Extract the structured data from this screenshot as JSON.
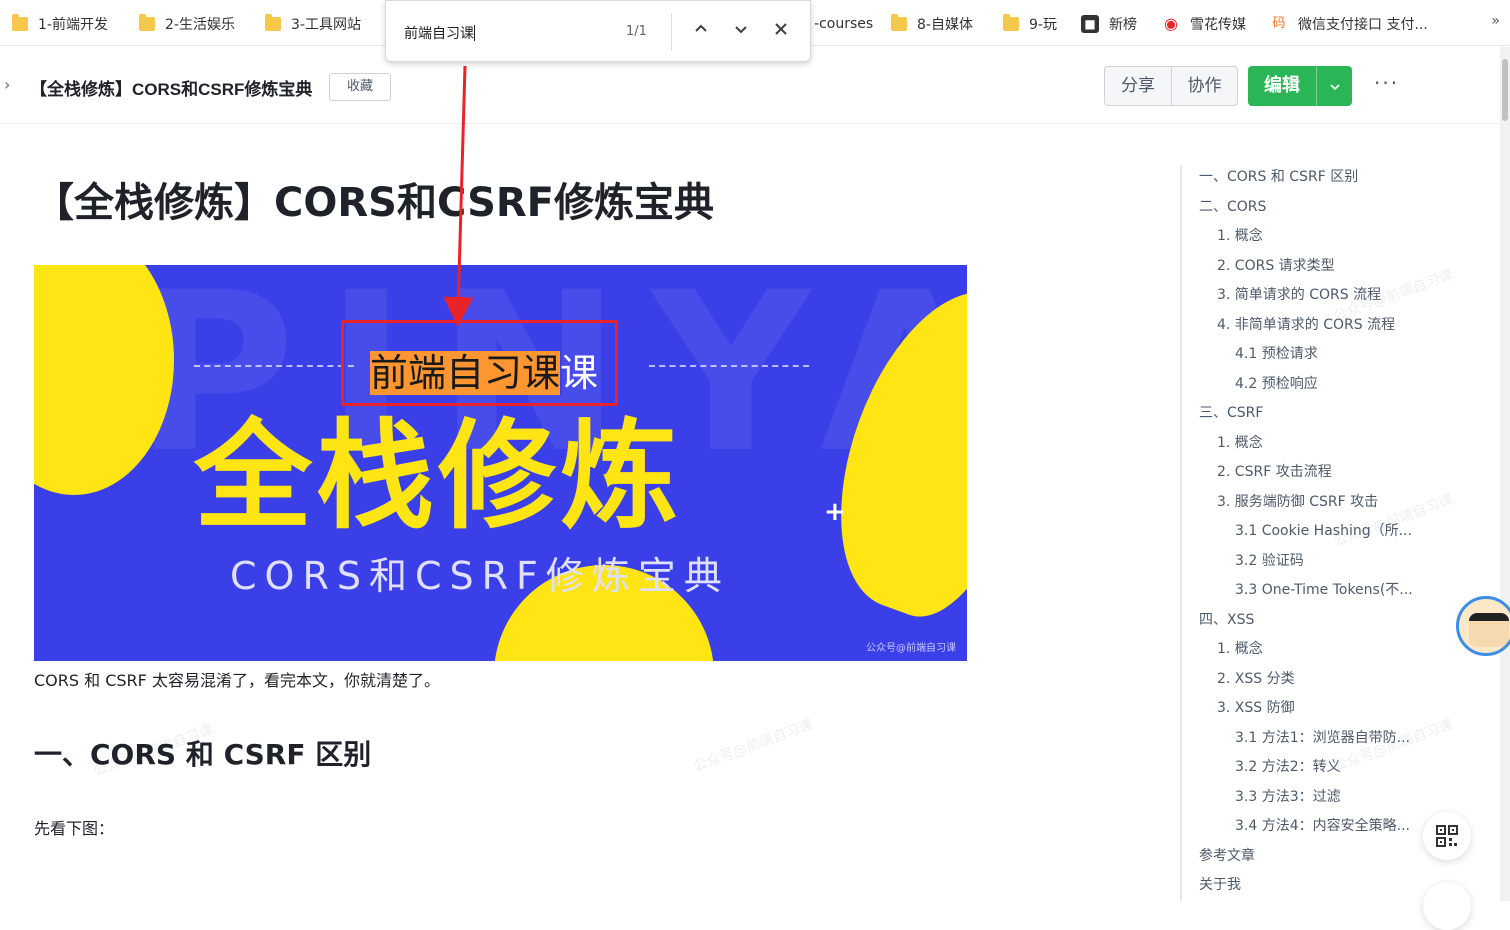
{
  "bookmarks": {
    "items": [
      {
        "label": "1-前端开发",
        "icon": "folder-icon"
      },
      {
        "label": "2-生活娱乐",
        "icon": "folder-icon"
      },
      {
        "label": "3-工具网站",
        "icon": "folder-icon"
      },
      {
        "label": "-courses",
        "icon": "folder-icon"
      },
      {
        "label": "8-自媒体",
        "icon": "folder-icon"
      },
      {
        "label": "9-玩",
        "icon": "folder-icon"
      },
      {
        "label": "新榜",
        "icon": "xinbang-icon"
      },
      {
        "label": "雪花传媒",
        "icon": "xuehua-icon"
      },
      {
        "label": "微信支付接口 支付...",
        "icon": "wechatpay-icon"
      }
    ],
    "more": "»"
  },
  "find_bar": {
    "query": "前端自习课",
    "count": "1/1",
    "prev": "^",
    "next": "v",
    "close": "✕"
  },
  "header": {
    "collapse_icon": "›",
    "title": "【全栈修炼】CORS和CSRF修炼宝典",
    "favorite": "收藏",
    "share": "分享",
    "collaborate": "协作",
    "edit": "编辑",
    "edit_caret": "⌄",
    "more": "···"
  },
  "article": {
    "title": "【全栈修炼】CORS和CSRF修炼宝典",
    "banner": {
      "subtitle_highlight": "前端自习课",
      "subtitle_rest": "课",
      "main": "全栈修炼",
      "plus": "+",
      "english": "CORS和CSRF修炼宝典",
      "watermark": "公众号@前端自习课"
    },
    "intro": "CORS 和 CSRF 太容易混淆了，看完本文，你就清楚了。",
    "section1_heading": "一、CORS 和 CSRF 区别",
    "section1_text": "先看下图："
  },
  "toc": [
    {
      "label": "一、CORS 和 CSRF 区别",
      "level": 1
    },
    {
      "label": "二、CORS",
      "level": 1
    },
    {
      "label": "1. 概念",
      "level": 2
    },
    {
      "label": "2. CORS 请求类型",
      "level": 2
    },
    {
      "label": "3. 简单请求的 CORS 流程",
      "level": 2
    },
    {
      "label": "4. 非简单请求的 CORS 流程",
      "level": 2
    },
    {
      "label": "4.1 预检请求",
      "level": 3
    },
    {
      "label": "4.2 预检响应",
      "level": 3
    },
    {
      "label": "三、CSRF",
      "level": 1
    },
    {
      "label": "1. 概念",
      "level": 2
    },
    {
      "label": "2. CSRF 攻击流程",
      "level": 2
    },
    {
      "label": "3. 服务端防御 CSRF 攻击",
      "level": 2
    },
    {
      "label": "3.1 Cookie Hashing（所...",
      "level": 3
    },
    {
      "label": "3.2 验证码",
      "level": 3
    },
    {
      "label": "3.3 One-Time Tokens(不...",
      "level": 3
    },
    {
      "label": "四、XSS",
      "level": 1
    },
    {
      "label": "1. 概念",
      "level": 2
    },
    {
      "label": "2. XSS 分类",
      "level": 2
    },
    {
      "label": "3. XSS 防御",
      "level": 2
    },
    {
      "label": "3.1 方法1：浏览器自带防...",
      "level": 3
    },
    {
      "label": "3.2 方法2：转义",
      "level": 3
    },
    {
      "label": "3.3 方法3：过滤",
      "level": 3
    },
    {
      "label": "3.4 方法4：内容安全策略...",
      "level": 3
    },
    {
      "label": "参考文章",
      "level": 1
    },
    {
      "label": "关于我",
      "level": 1
    }
  ],
  "watermark_text": "公众号@前端自习课",
  "colors": {
    "accent_green": "#2ab656",
    "banner_blue": "#3b3fe8",
    "banner_yellow": "#ffe513",
    "highlight_orange": "#ff9632",
    "annotation_red": "#e8232a"
  }
}
